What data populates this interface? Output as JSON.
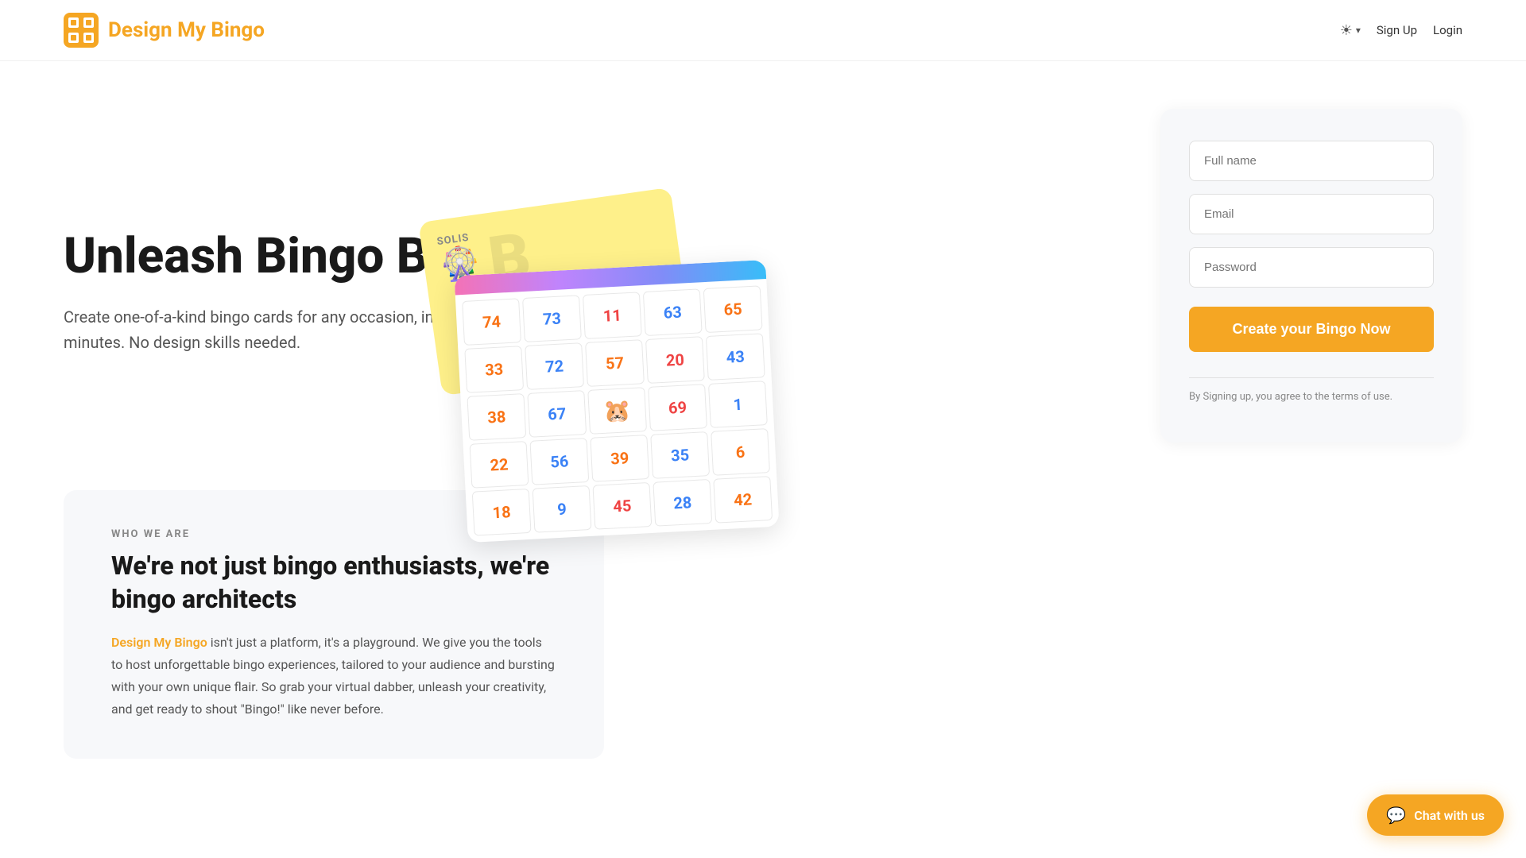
{
  "header": {
    "logo_text": "Design My Bingo",
    "nav": {
      "signup_label": "Sign Up",
      "login_label": "Login",
      "theme_icon": "☀"
    }
  },
  "hero": {
    "title": "Unleash Bingo Bliss!",
    "subtitle": "Create one-of-a-kind bingo cards for any occasion, in minutes. No design skills needed."
  },
  "form": {
    "fullname_placeholder": "Full name",
    "email_placeholder": "Email",
    "password_placeholder": "Password",
    "cta_label": "Create your Bingo Now",
    "terms_text": "By Signing up, you agree to the terms of use."
  },
  "bingo_grid": {
    "cells": [
      {
        "value": "74",
        "color": "orange"
      },
      {
        "value": "73",
        "color": "blue"
      },
      {
        "value": "11",
        "color": "red"
      },
      {
        "value": "63",
        "color": "blue"
      },
      {
        "value": "65",
        "color": "orange"
      },
      {
        "value": "33",
        "color": "orange"
      },
      {
        "value": "72",
        "color": "blue"
      },
      {
        "value": "57",
        "color": "orange"
      },
      {
        "value": "20",
        "color": "red"
      },
      {
        "value": "43",
        "color": "blue"
      },
      {
        "value": "38",
        "color": "orange"
      },
      {
        "value": "67",
        "color": "blue"
      },
      {
        "value": "🐹",
        "color": "emoji"
      },
      {
        "value": "69",
        "color": "red"
      },
      {
        "value": "1",
        "color": "blue"
      },
      {
        "value": "22",
        "color": "orange"
      },
      {
        "value": "56",
        "color": "blue"
      },
      {
        "value": "39",
        "color": "orange"
      },
      {
        "value": "35",
        "color": "blue"
      },
      {
        "value": "6",
        "color": "orange"
      },
      {
        "value": "18",
        "color": "orange"
      },
      {
        "value": "9",
        "color": "blue"
      },
      {
        "value": "45",
        "color": "red"
      },
      {
        "value": "28",
        "color": "blue"
      },
      {
        "value": "42",
        "color": "orange"
      }
    ]
  },
  "who_section": {
    "label": "WHO WE ARE",
    "title": "We're not just bingo enthusiasts, we're bingo architects",
    "brand": "Design My Bingo",
    "body_before": " isn't just a platform, it's a playground. We give you the tools to host unforgettable bingo experiences, tailored to your audience and bursting with your own unique flair. So grab your virtual dabber, unleash your creativity, and get ready to shout \"Bingo!\" like never before."
  },
  "chat_widget": {
    "label": "Chat with us",
    "icon": "💬"
  }
}
